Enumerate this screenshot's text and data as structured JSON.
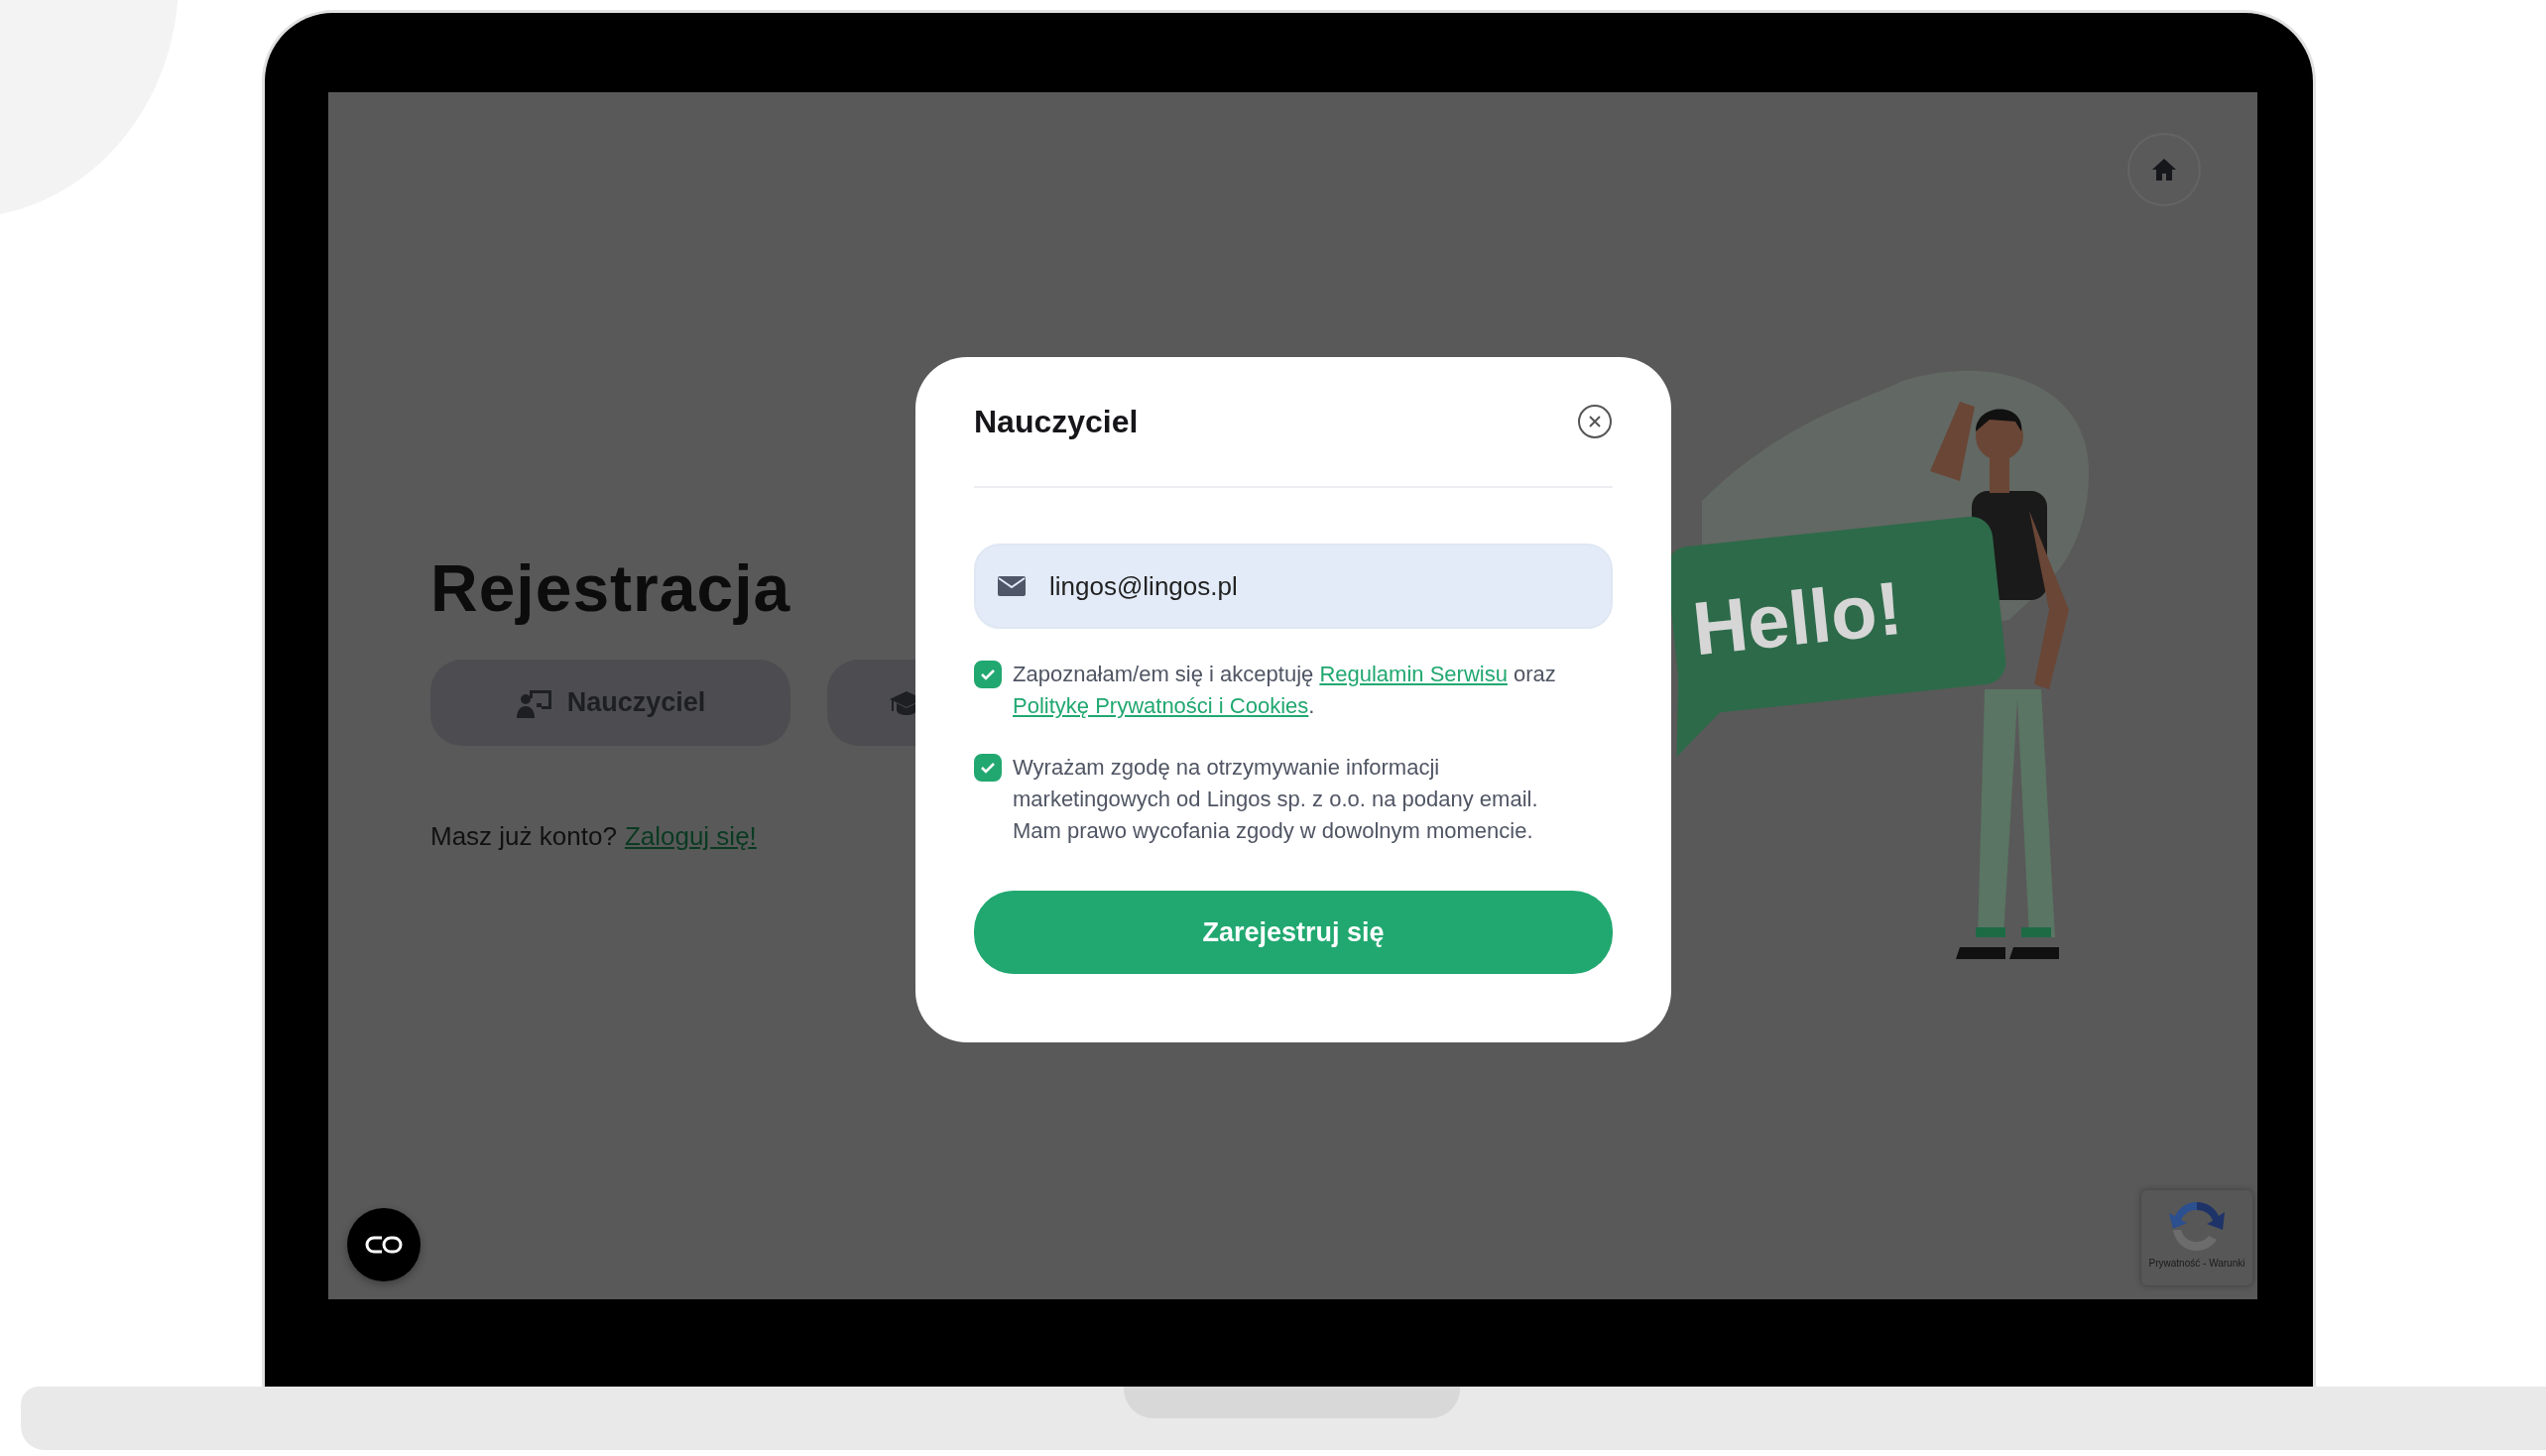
{
  "page": {
    "title": "Rejestracja",
    "role_tabs": [
      {
        "label": "Nauczyciel",
        "kind": "teacher"
      },
      {
        "kind": "student"
      }
    ],
    "login_prompt": "Masz już konto?",
    "login_link": "Zaloguj się!"
  },
  "illustration": {
    "sign_text": "Hello!"
  },
  "recaptcha": {
    "links": "Prywatność - Warunki"
  },
  "modal": {
    "title": "Nauczyciel",
    "email": {
      "value": "lingos@lingos.pl"
    },
    "consents": [
      {
        "checked": true,
        "parts": [
          {
            "kind": "text",
            "text": "Zapoznałam/em się i akceptuję "
          },
          {
            "kind": "link",
            "text": "Regulamin Serwisu"
          },
          {
            "kind": "text",
            "text": " oraz "
          },
          {
            "kind": "link",
            "text": "Politykę Prywatności i Cookies"
          },
          {
            "kind": "text",
            "text": "."
          }
        ]
      },
      {
        "checked": true,
        "parts": [
          {
            "kind": "text",
            "text": "Wyrażam zgodę na otrzymywanie informacji marketingowych od Lingos sp. z o.o. na podany email. Mam prawo wycofania zgody w dowolnym momencie."
          }
        ]
      }
    ],
    "submit": "Zarejestruj się"
  }
}
